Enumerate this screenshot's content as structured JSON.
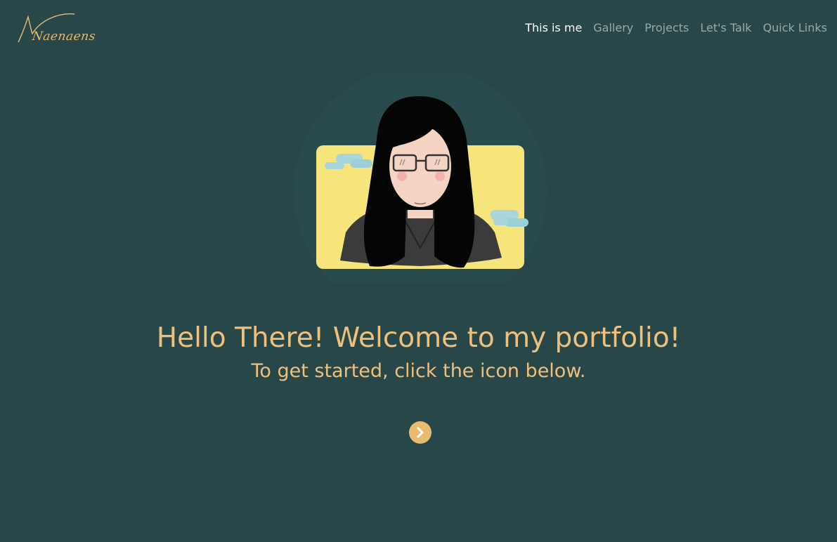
{
  "logo": {
    "text": "Naenaens"
  },
  "nav": {
    "items": [
      {
        "label": "This is me",
        "active": true
      },
      {
        "label": "Gallery",
        "active": false
      },
      {
        "label": "Projects",
        "active": false
      },
      {
        "label": "Let's Talk",
        "active": false
      },
      {
        "label": "Quick Links",
        "active": false
      }
    ]
  },
  "hero": {
    "title": "Hello There! Welcome to my portfolio!",
    "subtitle": "To get started, click the icon below.",
    "next_icon": "chevron-right-icon"
  },
  "colors": {
    "background": "#274749",
    "accent": "#e8bb70",
    "nav_active": "#ffffff",
    "nav_inactive": "#9aa8a9",
    "avatar_card": "#f6e57a"
  }
}
